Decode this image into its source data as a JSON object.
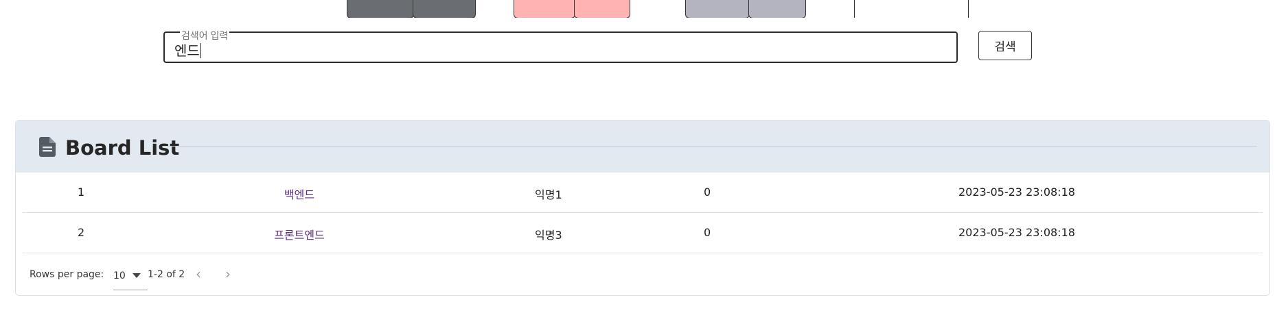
{
  "search": {
    "label": "검색어 입력",
    "value": "엔드",
    "button_label": "검색"
  },
  "board": {
    "title": "Board List",
    "rows": [
      {
        "no": "1",
        "title": "백엔드",
        "author": "익명1",
        "views": "0",
        "date": "2023-05-23 23:08:18"
      },
      {
        "no": "2",
        "title": "프론트엔드",
        "author": "익명3",
        "views": "0",
        "date": "2023-05-23 23:08:18"
      }
    ],
    "pagination": {
      "rows_per_page_label": "Rows per page:",
      "rows_per_page": "10",
      "range": "1-2 of 2",
      "prev_icon": "chevron-left-icon",
      "next_icon": "chevron-right-icon"
    }
  },
  "colors": {
    "header_bg": "#e3e9f0",
    "link": "#5b2c86",
    "border": "#2a2a2a"
  }
}
